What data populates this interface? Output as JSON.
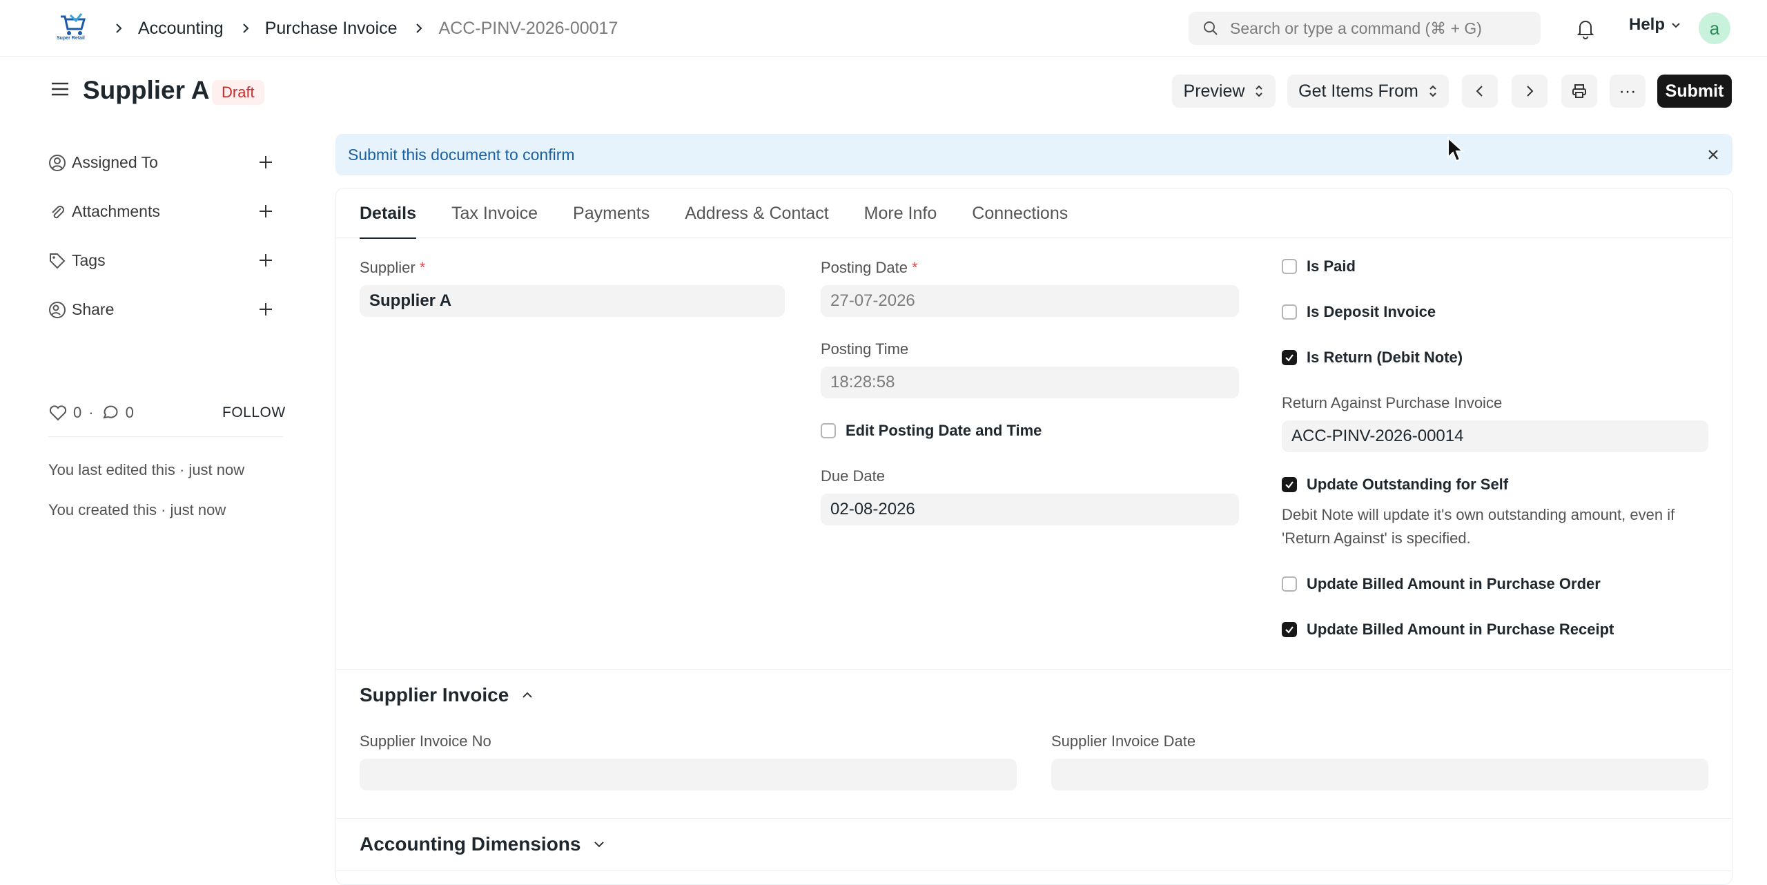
{
  "navbar": {
    "logo_label": "Super Retail",
    "breadcrumbs": [
      "Accounting",
      "Purchase Invoice",
      "ACC-PINV-2026-00017"
    ],
    "search_placeholder": "Search or type a command (⌘ + G)",
    "help_label": "Help",
    "avatar_initial": "a"
  },
  "page": {
    "title": "Supplier A",
    "status": "Draft",
    "buttons": {
      "preview": "Preview",
      "get_items": "Get Items From",
      "more": "···",
      "submit": "Submit"
    }
  },
  "sidebar": {
    "items": [
      {
        "label": "Assigned To",
        "icon": "user-icon"
      },
      {
        "label": "Attachments",
        "icon": "paperclip-icon"
      },
      {
        "label": "Tags",
        "icon": "tag-icon"
      },
      {
        "label": "Share",
        "icon": "share-icon"
      }
    ],
    "likes": "0",
    "comments": "0",
    "follow": "FOLLOW",
    "activity": [
      "You last edited this · just now",
      "You created this · just now"
    ]
  },
  "alert": {
    "message": "Submit this document to confirm"
  },
  "tabs": [
    "Details",
    "Tax Invoice",
    "Payments",
    "Address & Contact",
    "More Info",
    "Connections"
  ],
  "form": {
    "supplier_label": "Supplier",
    "supplier_value": "Supplier A",
    "posting_date_label": "Posting Date",
    "posting_date_value": "27-07-2026",
    "posting_time_label": "Posting Time",
    "posting_time_value": "18:28:58",
    "edit_posting_label": "Edit Posting Date and Time",
    "due_date_label": "Due Date",
    "due_date_value": "02-08-2026",
    "is_paid": "Is Paid",
    "is_deposit": "Is Deposit Invoice",
    "is_return": "Is Return (Debit Note)",
    "return_against_label": "Return Against Purchase Invoice",
    "return_against_value": "ACC-PINV-2026-00014",
    "update_outstanding": "Update Outstanding for Self",
    "update_outstanding_desc": "Debit Note will update it's own outstanding amount, even if 'Return Against' is specified.",
    "update_billed_po": "Update Billed Amount in Purchase Order",
    "update_billed_pr": "Update Billed Amount in Purchase Receipt"
  },
  "sections": {
    "supplier_invoice": "Supplier Invoice",
    "supplier_invoice_no": "Supplier Invoice No",
    "supplier_invoice_date": "Supplier Invoice Date",
    "accounting_dimensions": "Accounting Dimensions"
  },
  "colors": {
    "accent": "#171717",
    "draft_badge": "#cc2929",
    "alert_bg": "#e7f3fc",
    "alert_text": "#1a5f9f"
  }
}
